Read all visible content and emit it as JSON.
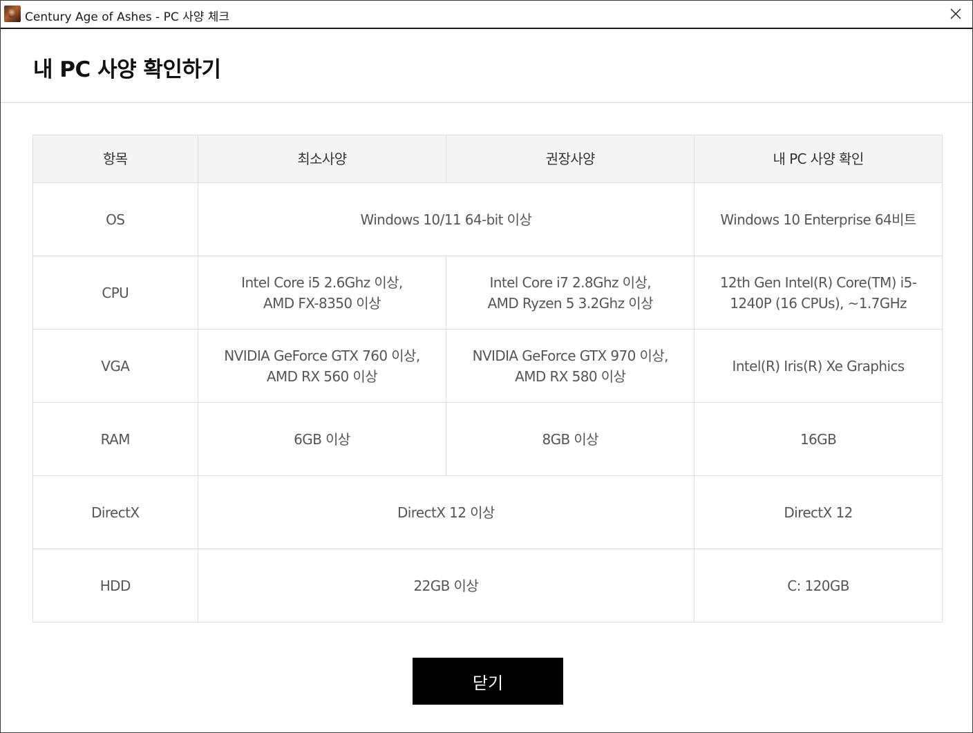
{
  "window": {
    "title": "Century Age of Ashes - PC 사양 체크"
  },
  "page": {
    "title": "내 PC 사양 확인하기"
  },
  "table": {
    "headers": {
      "item": "항목",
      "minimum": "최소사양",
      "recommended": "권장사양",
      "my_pc": "내 PC 사양 확인"
    },
    "rows": {
      "os": {
        "item": "OS",
        "min_and_rec": "Windows 10/11 64-bit 이상",
        "my_pc": "Windows 10 Enterprise 64비트"
      },
      "cpu": {
        "item": "CPU",
        "minimum_line1": "Intel Core i5 2.6Ghz 이상,",
        "minimum_line2": "AMD FX-8350 이상",
        "recommended_line1": "Intel Core i7 2.8Ghz 이상,",
        "recommended_line2": "AMD Ryzen 5 3.2Ghz 이상",
        "my_pc_line1": "12th Gen Intel(R) Core(TM) i5-",
        "my_pc_line2": "1240P (16 CPUs), ~1.7GHz"
      },
      "vga": {
        "item": "VGA",
        "minimum_line1": "NVIDIA GeForce GTX 760 이상,",
        "minimum_line2": "AMD RX 560 이상",
        "recommended_line1": "NVIDIA GeForce GTX 970 이상,",
        "recommended_line2": "AMD RX 580 이상",
        "my_pc": "Intel(R) Iris(R) Xe Graphics"
      },
      "ram": {
        "item": "RAM",
        "minimum": "6GB 이상",
        "recommended": "8GB 이상",
        "my_pc": "16GB"
      },
      "directx": {
        "item": "DirectX",
        "min_and_rec": "DirectX 12 이상",
        "my_pc": "DirectX 12"
      },
      "hdd": {
        "item": "HDD",
        "min_and_rec": "22GB 이상",
        "my_pc": "C: 120GB"
      }
    }
  },
  "footer": {
    "close_label": "닫기"
  },
  "icons": {
    "app": "app-icon",
    "close": "close-icon"
  }
}
